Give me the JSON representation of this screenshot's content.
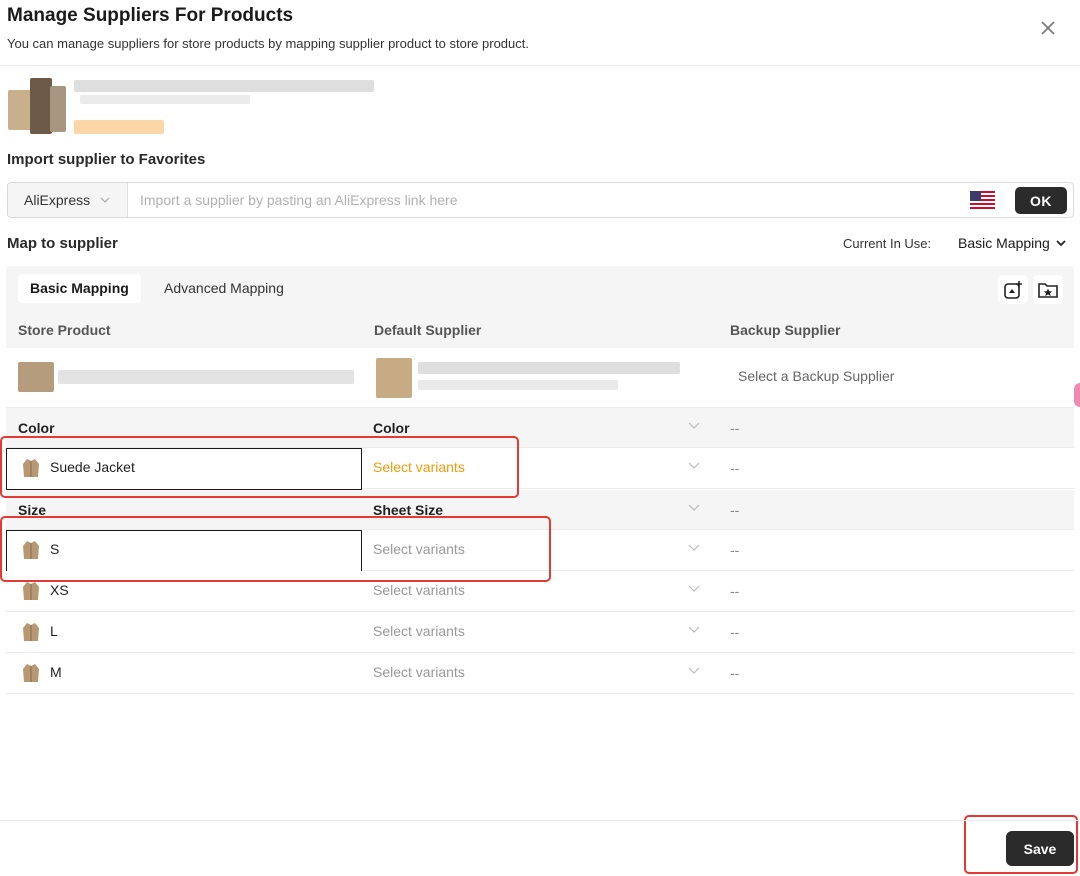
{
  "dialog": {
    "title": "Manage Suppliers For Products",
    "subtitle": "You can manage suppliers for store products by mapping supplier product to store product."
  },
  "import": {
    "section_title": "Import supplier to Favorites",
    "source": "AliExpress",
    "placeholder": "Import a supplier by pasting an AliExpress link here",
    "ok_label": "OK"
  },
  "mapping": {
    "section_title": "Map to supplier",
    "current_in_use_label": "Current In Use:",
    "current_mode": "Basic Mapping",
    "tabs": [
      "Basic Mapping",
      "Advanced Mapping"
    ],
    "columns": [
      "Store Product",
      "Default Supplier",
      "Backup Supplier"
    ],
    "backup_placeholder": "Select a Backup Supplier",
    "select_variants": "Select variants",
    "dash": "--",
    "groups": [
      {
        "store_attr": "Color",
        "supplier_attr": "Color",
        "variants": [
          "Suede Jacket"
        ]
      },
      {
        "store_attr": "Size",
        "supplier_attr": "Sheet Size",
        "variants": [
          "S",
          "XS",
          "L",
          "M"
        ]
      }
    ]
  },
  "footer": {
    "save_label": "Save"
  },
  "colors": {
    "accent_orange": "#f29a0b",
    "dark_button": "#2b2b2b",
    "highlight_red": "#e53935"
  },
  "icons": [
    "close-icon",
    "chevron-down-icon",
    "us-flag-icon",
    "add-product-icon",
    "folder-star-icon",
    "jacket-icon"
  ]
}
